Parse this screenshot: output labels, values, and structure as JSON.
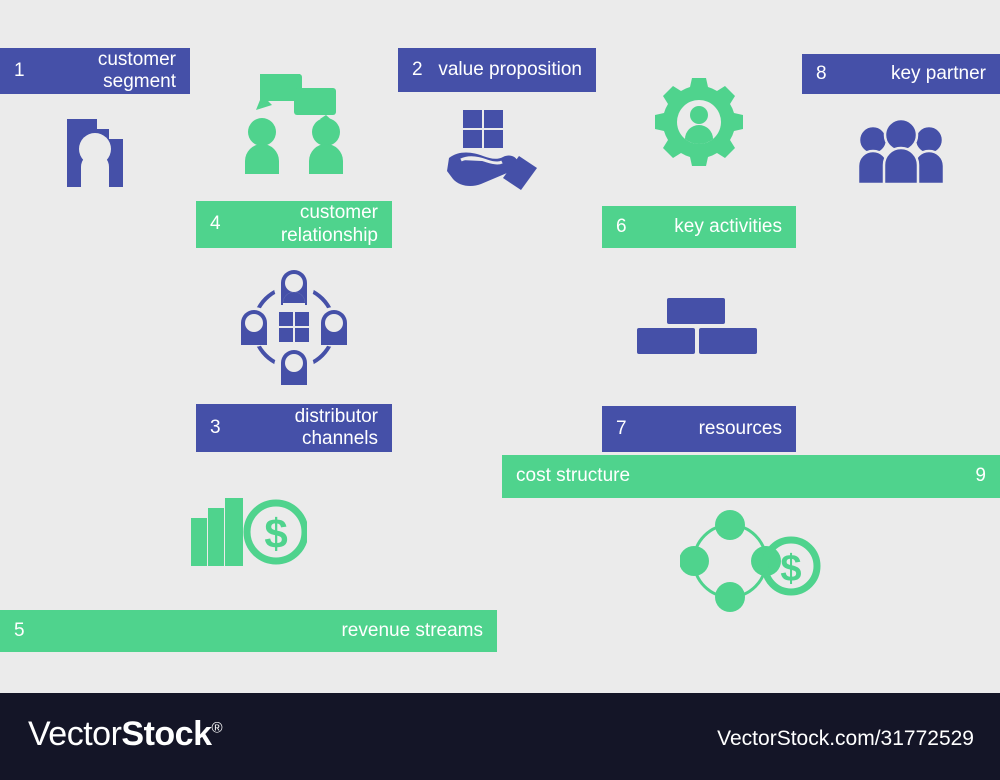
{
  "canvas": {
    "background_color": "#ebebeb",
    "blue": "#4550a8",
    "green": "#4fd38d",
    "blocks": [
      {
        "id": "customer-segment",
        "number": "1",
        "label": "customer\nsegment",
        "color": "blue",
        "bar_position": "top",
        "number_side": "left",
        "icon": "person-in-frame-icon"
      },
      {
        "id": "customer-relationship",
        "number": "4",
        "label": "customer\nrelationship",
        "color": "green",
        "bar_position": "bottom",
        "number_side": "left",
        "icon": "two-people-chat-bubbles-icon"
      },
      {
        "id": "distributor-channels",
        "number": "3",
        "label": "distributor\nchannels",
        "color": "blue",
        "bar_position": "bottom",
        "number_side": "left",
        "icon": "network-people-around-grid-icon"
      },
      {
        "id": "value-proposition",
        "number": "2",
        "label": "value proposition",
        "color": "blue",
        "bar_position": "top",
        "number_side": "left",
        "icon": "hand-holding-grid-icon"
      },
      {
        "id": "key-activities",
        "number": "6",
        "label": "key activities",
        "color": "green",
        "bar_position": "bottom",
        "number_side": "left",
        "icon": "gear-person-icon"
      },
      {
        "id": "resources",
        "number": "7",
        "label": "resources",
        "color": "blue",
        "bar_position": "bottom",
        "number_side": "left",
        "icon": "bricks-icon"
      },
      {
        "id": "key-partner",
        "number": "8",
        "label": "key partner",
        "color": "blue",
        "bar_position": "top",
        "number_side": "left",
        "icon": "group-of-people-icon"
      },
      {
        "id": "revenue-streams",
        "number": "5",
        "label": "revenue streams",
        "color": "green",
        "bar_position": "bottom",
        "number_side": "left",
        "icon": "bar-chart-dollar-coin-icon"
      },
      {
        "id": "cost-structure",
        "number": "9",
        "label": "cost structure",
        "color": "green",
        "bar_position": "top",
        "number_side": "right",
        "icon": "network-nodes-dollar-coin-icon"
      }
    ]
  },
  "watermark": {
    "brand_vector": "Vector",
    "brand_stock": "Stock",
    "registered_mark": "®",
    "url": "VectorStock.com/31772529",
    "background_color": "#141527"
  }
}
